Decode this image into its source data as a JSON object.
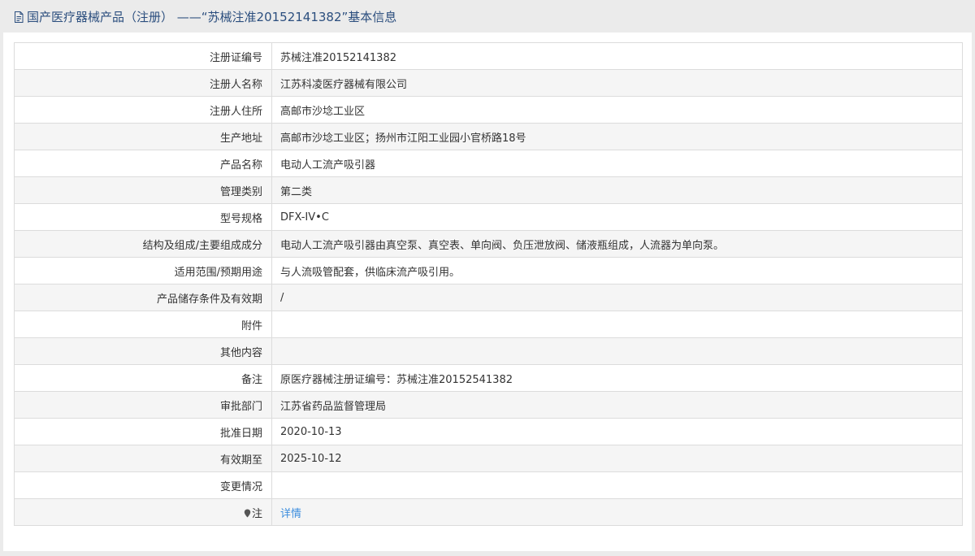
{
  "header": {
    "title": "国产医疗器械产品（注册）  ——“苏械注准20152141382”基本信息",
    "icon": "document-icon",
    "color": "#2b4e7e"
  },
  "rows": [
    {
      "label": "注册证编号",
      "value": "苏械注准20152141382"
    },
    {
      "label": "注册人名称",
      "value": "江苏科凌医疗器械有限公司"
    },
    {
      "label": "注册人住所",
      "value": "高邮市沙埝工业区"
    },
    {
      "label": "生产地址",
      "value": "高邮市沙埝工业区；扬州市江阳工业园小官桥路18号"
    },
    {
      "label": "产品名称",
      "value": "电动人工流产吸引器"
    },
    {
      "label": "管理类别",
      "value": "第二类"
    },
    {
      "label": "型号规格",
      "value": "DFX-IV•C"
    },
    {
      "label": "结构及组成/主要组成成分",
      "value": "电动人工流产吸引器由真空泵、真空表、单向阀、负压泄放阀、储液瓶组成，人流器为单向泵。"
    },
    {
      "label": "适用范围/预期用途",
      "value": "与人流吸管配套，供临床流产吸引用。"
    },
    {
      "label": "产品储存条件及有效期",
      "value": "/"
    },
    {
      "label": "附件",
      "value": ""
    },
    {
      "label": "其他内容",
      "value": ""
    },
    {
      "label": "备注",
      "value": "原医疗器械注册证编号：苏械注准20152541382"
    },
    {
      "label": "审批部门",
      "value": "江苏省药品监督管理局"
    },
    {
      "label": "批准日期",
      "value": "2020-10-13"
    },
    {
      "label": "有效期至",
      "value": "2025-10-12"
    },
    {
      "label": "变更情况",
      "value": ""
    }
  ],
  "note_row": {
    "label": "注",
    "link_text": "详情",
    "icon": "pin-icon",
    "link_color": "#3c8dde"
  }
}
